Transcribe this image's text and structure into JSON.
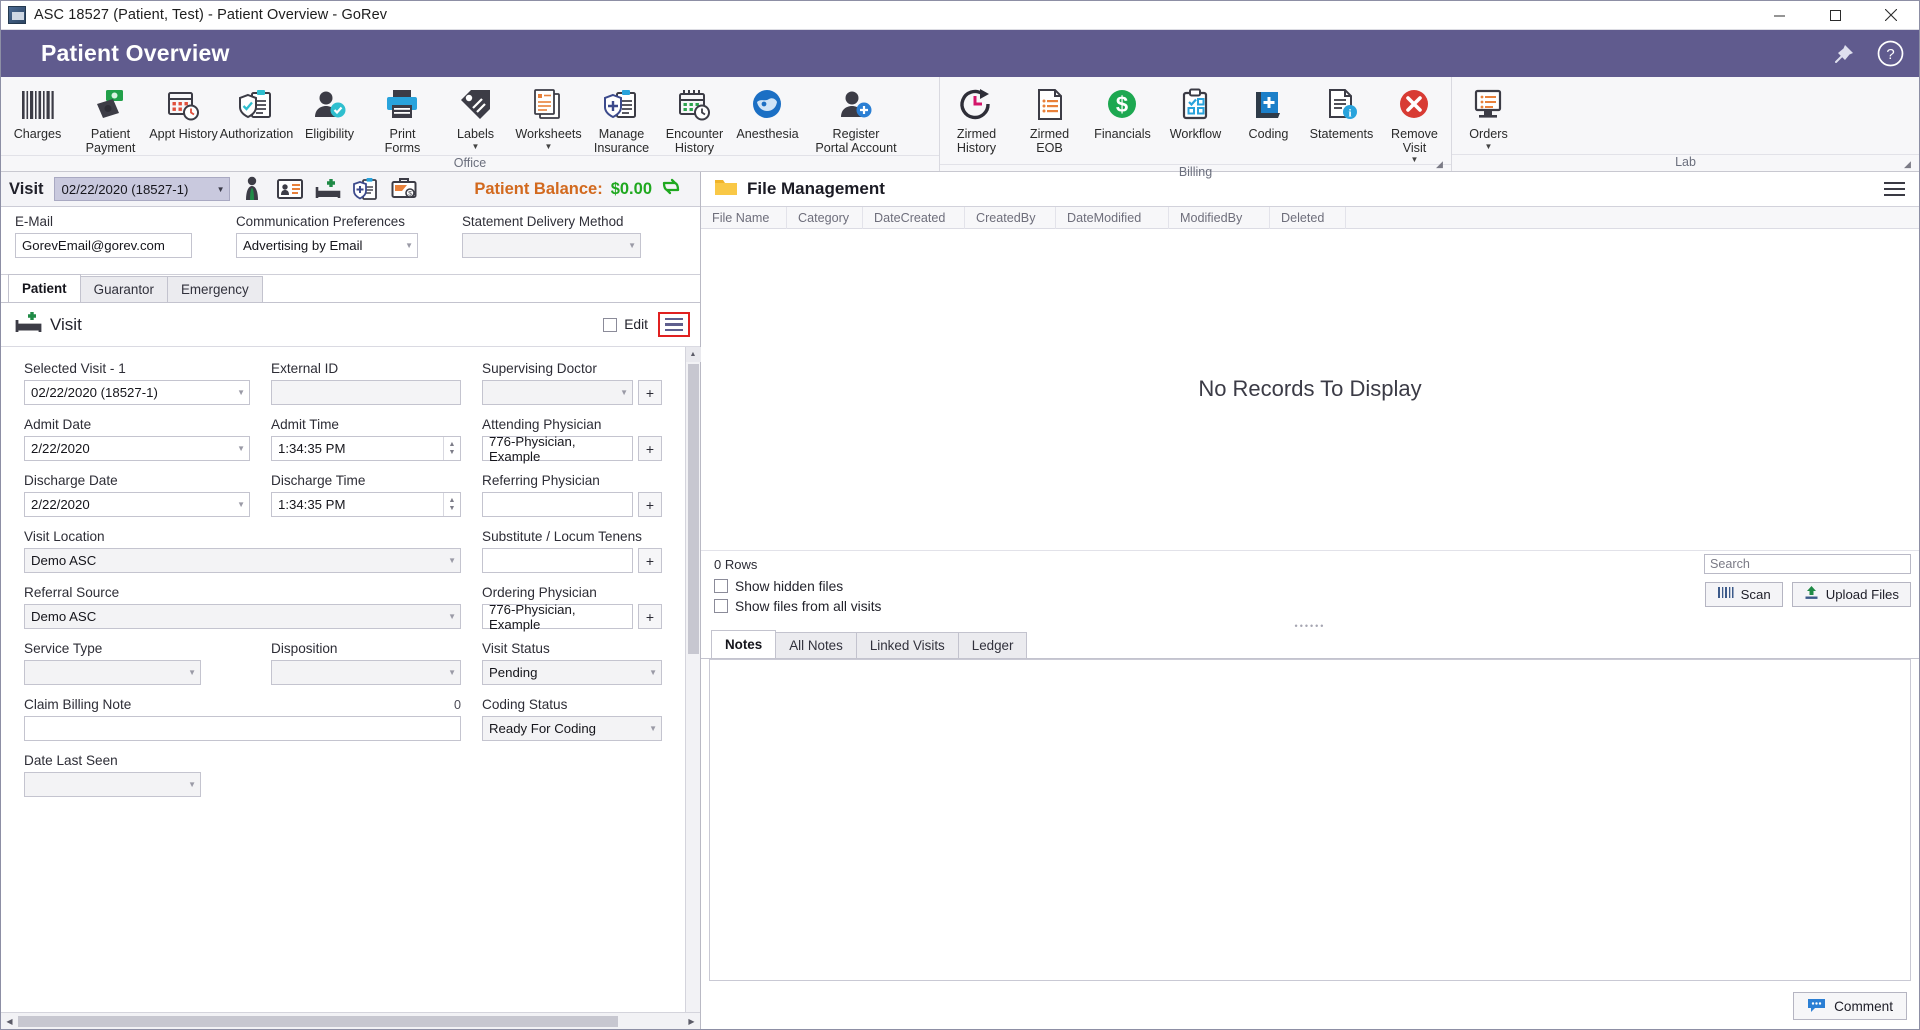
{
  "window": {
    "title": "ASC 18527 (Patient, Test) - Patient Overview - GoRev",
    "minimize_label": "Minimize",
    "maximize_label": "Maximize",
    "close_label": "Close"
  },
  "header": {
    "title": "Patient Overview",
    "pin_icon": "pin-icon",
    "help_icon": "help-icon"
  },
  "ribbon": {
    "groups": [
      {
        "name": "Office",
        "label": "Office",
        "buttons": [
          {
            "label": "Charges",
            "icon": "barcode-icon",
            "caret": false
          },
          {
            "label": "Patient\nPayment",
            "icon": "money-wallet-icon",
            "caret": false
          },
          {
            "label": "Appt History",
            "icon": "calendar-clock-icon",
            "caret": false
          },
          {
            "label": "Authorization",
            "icon": "shield-clipboard-icon",
            "caret": false
          },
          {
            "label": "Eligibility",
            "icon": "person-check-icon",
            "caret": false
          },
          {
            "label": "Print\nForms",
            "icon": "printer-icon",
            "caret": false
          },
          {
            "label": "Labels",
            "icon": "tags-icon",
            "caret": true
          },
          {
            "label": "Worksheets",
            "icon": "documents-icon",
            "caret": true
          },
          {
            "label": "Manage\nInsurance",
            "icon": "insurance-shield-icon",
            "caret": false
          },
          {
            "label": "Encounter\nHistory",
            "icon": "calendar-check-clock-icon",
            "caret": false
          },
          {
            "label": "Anesthesia",
            "icon": "anesthesia-globe-icon",
            "caret": false
          },
          {
            "label": "Register\nPortal Account",
            "icon": "person-add-icon",
            "caret": false
          }
        ]
      },
      {
        "name": "Billing",
        "label": "Billing",
        "buttons": [
          {
            "label": "Zirmed\nHistory",
            "icon": "refresh-clock-icon",
            "caret": false
          },
          {
            "label": "Zirmed\nEOB",
            "icon": "document-list-icon",
            "caret": false
          },
          {
            "label": "Financials",
            "icon": "dollar-circle-icon",
            "caret": false
          },
          {
            "label": "Workflow",
            "icon": "clipboard-check-icon",
            "caret": false
          },
          {
            "label": "Coding",
            "icon": "book-plus-icon",
            "caret": false
          },
          {
            "label": "Statements",
            "icon": "document-info-icon",
            "caret": false
          },
          {
            "label": "Remove\nVisit",
            "icon": "remove-circle-icon",
            "caret": true
          }
        ]
      },
      {
        "name": "Lab",
        "label": "Lab",
        "buttons": [
          {
            "label": "Orders",
            "icon": "orders-monitor-icon",
            "caret": true
          }
        ]
      }
    ]
  },
  "visit_toolbar": {
    "visit_label": "Visit",
    "visit_value": "02/22/2020 (18527-1)",
    "icons": [
      {
        "name": "patient-gown-icon"
      },
      {
        "name": "id-card-icon"
      },
      {
        "name": "admit-bed-icon"
      },
      {
        "name": "insurance-verify-icon"
      },
      {
        "name": "billing-briefcase-icon"
      }
    ],
    "balance_label": "Patient Balance:",
    "balance_value": "$0.00",
    "refresh_icon": "refresh-balance-icon",
    "balance_color": "#1fa81f"
  },
  "contact": {
    "email_label": "E-Mail",
    "email_value": "GorevEmail@gorev.com",
    "comm_label": "Communication Preferences",
    "comm_value": "Advertising by Email",
    "stmt_label": "Statement Delivery Method",
    "stmt_value": ""
  },
  "tabs": {
    "items": [
      {
        "label": "Patient",
        "active": true
      },
      {
        "label": "Guarantor",
        "active": false
      },
      {
        "label": "Emergency",
        "active": false
      }
    ]
  },
  "visit_card": {
    "title": "Visit",
    "icon": "bed-add-icon",
    "edit_label": "Edit",
    "edit_checked": false,
    "menu_icon": "hamburger-menu-icon",
    "menu_highlight_color": "#e02020",
    "fields": {
      "selected_visit_label": "Selected Visit - 1",
      "selected_visit_value": "02/22/2020 (18527-1)",
      "external_id_label": "External ID",
      "external_id_value": "",
      "supervising_doctor_label": "Supervising Doctor",
      "supervising_doctor_value": "",
      "admit_date_label": "Admit Date",
      "admit_date_value": "2/22/2020",
      "admit_time_label": "Admit Time",
      "admit_time_value": "1:34:35 PM",
      "attending_physician_label": "Attending Physician",
      "attending_physician_value": "776-Physician, Example",
      "discharge_date_label": "Discharge Date",
      "discharge_date_value": "2/22/2020",
      "discharge_time_label": "Discharge Time",
      "discharge_time_value": "1:34:35 PM",
      "referring_physician_label": "Referring Physician",
      "referring_physician_value": "",
      "visit_location_label": "Visit Location",
      "visit_location_value": "Demo ASC",
      "substitute_label": "Substitute / Locum Tenens",
      "substitute_value": "",
      "referral_source_label": "Referral Source",
      "referral_source_value": "Demo ASC",
      "ordering_physician_label": "Ordering Physician",
      "ordering_physician_value": "776-Physician, Example",
      "service_type_label": "Service Type",
      "service_type_value": "",
      "disposition_label": "Disposition",
      "disposition_value": "",
      "visit_status_label": "Visit Status",
      "visit_status_value": "Pending",
      "claim_billing_note_label": "Claim Billing Note",
      "claim_billing_note_count": "0",
      "claim_billing_note_value": "",
      "coding_status_label": "Coding Status",
      "coding_status_value": "Ready For Coding",
      "date_last_seen_label": "Date Last Seen",
      "date_last_seen_value": "",
      "plus_button_label": "+"
    }
  },
  "file_management": {
    "title": "File Management",
    "folder_icon": "folder-icon",
    "menu_icon": "hamburger-menu-icon",
    "columns": [
      "File Name",
      "Category",
      "DateCreated",
      "CreatedBy",
      "DateModified",
      "ModifiedBy",
      "Deleted"
    ],
    "empty_message": "No Records To Display",
    "rows_label": "0 Rows",
    "search_placeholder": "Search",
    "search_value": "",
    "show_hidden_label": "Show hidden files",
    "show_hidden_checked": false,
    "show_all_visits_label": "Show files from all visits",
    "show_all_visits_checked": false,
    "scan_label": "Scan",
    "scan_icon": "scanner-icon",
    "upload_label": "Upload Files",
    "upload_icon": "upload-icon"
  },
  "notes_panel": {
    "tabs": [
      {
        "label": "Notes",
        "active": true
      },
      {
        "label": "All Notes",
        "active": false
      },
      {
        "label": "Linked Visits",
        "active": false
      },
      {
        "label": "Ledger",
        "active": false
      }
    ],
    "content": "",
    "comment_label": "Comment",
    "comment_icon": "comment-icon"
  }
}
